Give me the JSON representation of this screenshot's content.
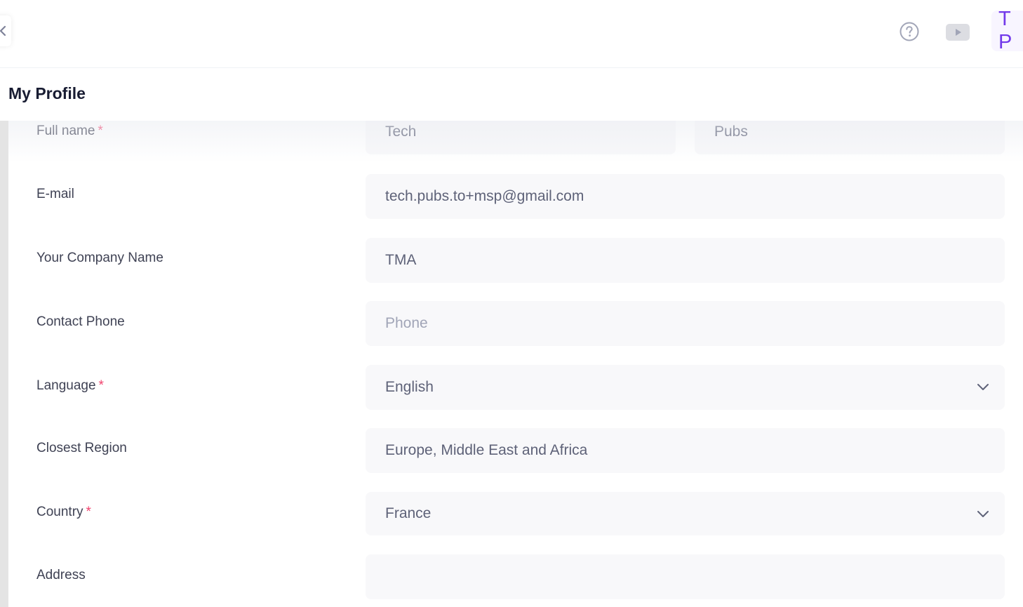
{
  "header": {
    "avatar_initials": "T P",
    "help_icon": "question-circle-icon",
    "video_icon": "play-video-icon",
    "collapse_icon": "chevron-left-icon",
    "accent_color": "#7239ea"
  },
  "page": {
    "title": "My Profile"
  },
  "form": {
    "full_name": {
      "label": "Full name",
      "required_mark": "*",
      "first_name": "Tech",
      "last_name": "Pubs"
    },
    "email": {
      "label": "E-mail",
      "value": "tech.pubs.to+msp@gmail.com"
    },
    "company": {
      "label": "Your Company Name",
      "value": "TMA"
    },
    "phone": {
      "label": "Contact Phone",
      "value": "",
      "placeholder": "Phone"
    },
    "language": {
      "label": "Language",
      "required_mark": "*",
      "value": "English"
    },
    "region": {
      "label": "Closest Region",
      "value": "Europe, Middle East and Africa"
    },
    "country": {
      "label": "Country",
      "required_mark": "*",
      "value": "France"
    },
    "address": {
      "label": "Address",
      "value": ""
    }
  }
}
